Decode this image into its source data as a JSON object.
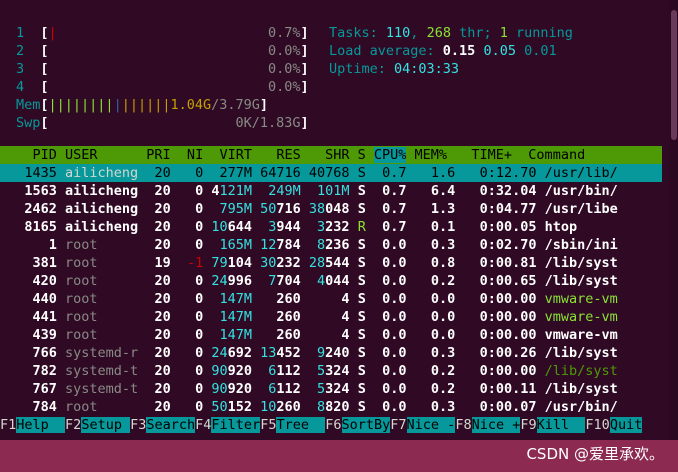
{
  "meters": {
    "cpu": [
      {
        "id": "1",
        "bar": "|",
        "value": "0.7%"
      },
      {
        "id": "2",
        "bar": "",
        "value": "0.0%"
      },
      {
        "id": "3",
        "bar": "",
        "value": "0.0%"
      },
      {
        "id": "4",
        "bar": "",
        "value": "0.0%"
      }
    ],
    "mem": {
      "label": "Mem",
      "bar_green": "||||||||",
      "bar_blue": "|",
      "bar_yellow": "||||||",
      "used": "1.04G",
      "total": "/3.79G"
    },
    "swp": {
      "label": "Swp",
      "value": "0K/1.83G"
    }
  },
  "summary": {
    "tasks_label": "Tasks:",
    "tasks": "110",
    "thr": "268",
    "thr_label": "thr;",
    "running": "1",
    "running_label": "running",
    "load_label": "Load average:",
    "load1": "0.15",
    "load5": "0.05",
    "load15": "0.01",
    "uptime_label": "Uptime:",
    "uptime": "04:03:33"
  },
  "columns": {
    "pid": "PID",
    "user": "USER",
    "pri": "PRI",
    "ni": "NI",
    "virt": "VIRT",
    "res": "RES",
    "shr": "SHR",
    "s": "S",
    "cpu": "CPU%",
    "mem": "MEM%",
    "time": "TIME+",
    "command": "Command"
  },
  "processes": [
    {
      "pid": "1435",
      "user": "ailicheng",
      "pri": "20",
      "ni": "0",
      "virt": "277M",
      "res": "64716",
      "shr": "40768",
      "s": "S",
      "cpu": "0.7",
      "mem": "1.6",
      "time": "0:12.70",
      "command": "/usr/lib/"
    },
    {
      "pid": "1563",
      "user": "ailicheng",
      "pri": "20",
      "ni": "0",
      "virt": "4121M",
      "res": "249M",
      "shr": "101M",
      "s": "S",
      "cpu": "0.7",
      "mem": "6.4",
      "time": "0:32.04",
      "command": "/usr/bin/"
    },
    {
      "pid": "2462",
      "user": "ailicheng",
      "pri": "20",
      "ni": "0",
      "virt": "795M",
      "res": "50716",
      "shr": "38048",
      "s": "S",
      "cpu": "0.7",
      "mem": "1.3",
      "time": "0:04.77",
      "command": "/usr/libe"
    },
    {
      "pid": "8165",
      "user": "ailicheng",
      "pri": "20",
      "ni": "0",
      "virt": "10644",
      "res": "3944",
      "shr": "3232",
      "s": "R",
      "cpu": "0.7",
      "mem": "0.1",
      "time": "0:00.05",
      "command": "htop"
    },
    {
      "pid": "1",
      "user": "root",
      "pri": "20",
      "ni": "0",
      "virt": "165M",
      "res": "12784",
      "shr": "8236",
      "s": "S",
      "cpu": "0.0",
      "mem": "0.3",
      "time": "0:02.70",
      "command": "/sbin/ini"
    },
    {
      "pid": "381",
      "user": "root",
      "pri": "19",
      "ni": "-1",
      "virt": "79104",
      "res": "30232",
      "shr": "28544",
      "s": "S",
      "cpu": "0.0",
      "mem": "0.8",
      "time": "0:00.81",
      "command": "/lib/syst"
    },
    {
      "pid": "420",
      "user": "root",
      "pri": "20",
      "ni": "0",
      "virt": "24996",
      "res": "7704",
      "shr": "4044",
      "s": "S",
      "cpu": "0.0",
      "mem": "0.2",
      "time": "0:00.65",
      "command": "/lib/syst"
    },
    {
      "pid": "440",
      "user": "root",
      "pri": "20",
      "ni": "0",
      "virt": "147M",
      "res": "260",
      "shr": "4",
      "s": "S",
      "cpu": "0.0",
      "mem": "0.0",
      "time": "0:00.00",
      "command": "vmware-vm"
    },
    {
      "pid": "441",
      "user": "root",
      "pri": "20",
      "ni": "0",
      "virt": "147M",
      "res": "260",
      "shr": "4",
      "s": "S",
      "cpu": "0.0",
      "mem": "0.0",
      "time": "0:00.00",
      "command": "vmware-vm"
    },
    {
      "pid": "439",
      "user": "root",
      "pri": "20",
      "ni": "0",
      "virt": "147M",
      "res": "260",
      "shr": "4",
      "s": "S",
      "cpu": "0.0",
      "mem": "0.0",
      "time": "0:00.00",
      "command": "vmware-vm"
    },
    {
      "pid": "766",
      "user": "systemd-r",
      "pri": "20",
      "ni": "0",
      "virt": "24692",
      "res": "13452",
      "shr": "9240",
      "s": "S",
      "cpu": "0.0",
      "mem": "0.3",
      "time": "0:00.26",
      "command": "/lib/syst"
    },
    {
      "pid": "782",
      "user": "systemd-t",
      "pri": "20",
      "ni": "0",
      "virt": "90920",
      "res": "6112",
      "shr": "5324",
      "s": "S",
      "cpu": "0.0",
      "mem": "0.2",
      "time": "0:00.00",
      "command": "/lib/syst"
    },
    {
      "pid": "767",
      "user": "systemd-t",
      "pri": "20",
      "ni": "0",
      "virt": "90920",
      "res": "6112",
      "shr": "5324",
      "s": "S",
      "cpu": "0.0",
      "mem": "0.2",
      "time": "0:00.11",
      "command": "/lib/syst"
    },
    {
      "pid": "784",
      "user": "root",
      "pri": "20",
      "ni": "0",
      "virt": "50152",
      "res": "10260",
      "shr": "8820",
      "s": "S",
      "cpu": "0.0",
      "mem": "0.3",
      "time": "0:00.07",
      "command": "/usr/bin/"
    }
  ],
  "fkeys": [
    {
      "key": "F1",
      "label": "Help  "
    },
    {
      "key": "F2",
      "label": "Setup "
    },
    {
      "key": "F3",
      "label": "Search"
    },
    {
      "key": "F4",
      "label": "Filter"
    },
    {
      "key": "F5",
      "label": "Tree  "
    },
    {
      "key": "F6",
      "label": "SortBy"
    },
    {
      "key": "F7",
      "label": "Nice -"
    },
    {
      "key": "F8",
      "label": "Nice +"
    },
    {
      "key": "F9",
      "label": "Kill  "
    },
    {
      "key": "F10",
      "label": "Quit"
    }
  ],
  "watermark": "CSDN @爱里承欢。"
}
